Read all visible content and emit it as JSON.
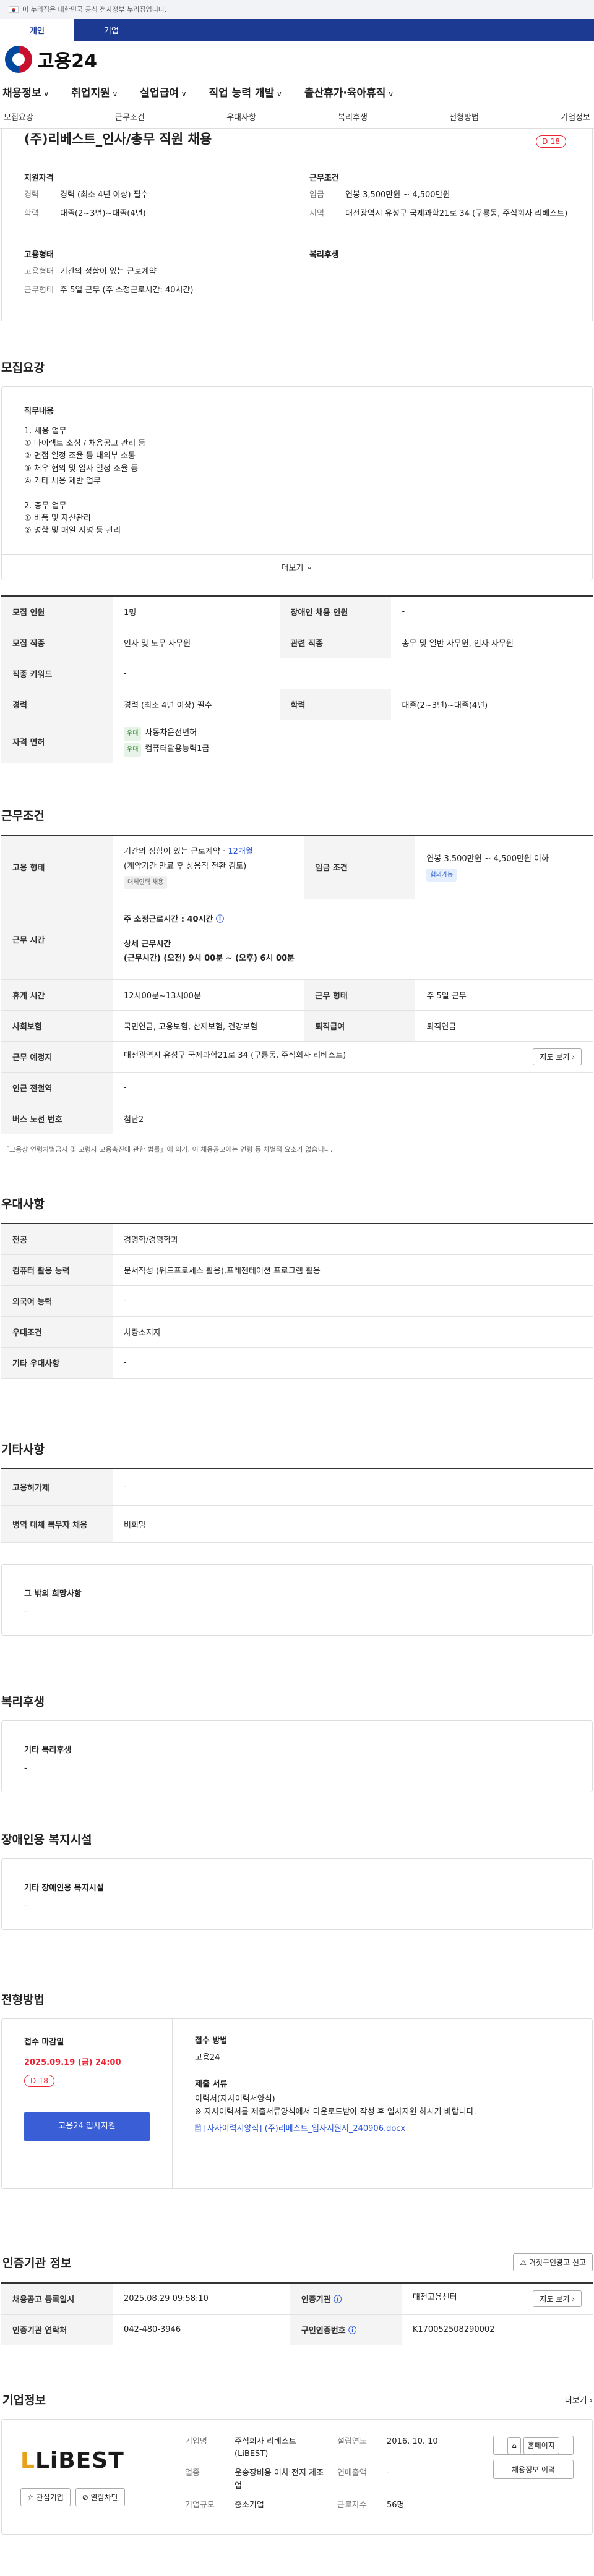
{
  "gov_banner": "이 누리집은 대한민국 공식 전자정부 누리집입니다.",
  "user_tabs": [
    "개인",
    "기업"
  ],
  "brand": "고용24",
  "gnb": [
    "채용정보",
    "취업지원",
    "실업급여",
    "직업 능력 개발",
    "출산휴가·육아휴직"
  ],
  "subnav": [
    "모집요강",
    "근무조건",
    "우대사항",
    "복리후생",
    "전형방법",
    "기업정보"
  ],
  "job": {
    "title": "(주)리베스트_인사/총무 직원 채용",
    "dday": "D-18"
  },
  "summary": {
    "qual_h": "지원자격",
    "cond_h": "근무조건",
    "type_h": "고용형태",
    "wel_h": "복리후생",
    "rows": [
      [
        "경력",
        "경력 (최소 4년 이상) 필수"
      ],
      [
        "학력",
        "대졸(2~3년)~대졸(4년)"
      ],
      [
        "임금",
        "연봉 3,500만원 ~ 4,500만원"
      ],
      [
        "지역",
        "대전광역시 유성구 국제과학21로 34 (구룡동, 주식회사 리베스트)"
      ],
      [
        "고용형태",
        "기간의 정함이 있는 근로계약"
      ],
      [
        "근무형태",
        "주 5일 근무 (주 소정근로시간: 40시간)"
      ]
    ]
  },
  "recruit": {
    "title": "모집요강",
    "duty_h": "직무내용",
    "duty": [
      "1. 채용 업무",
      "① 다이렉트 소싱 / 채용공고 관리 등",
      "② 면접 일정 조율 등 내외부 소통",
      "③ 처우 협의 및 입사 일정 조율 등",
      "④ 기타 채용 제반 업무",
      "",
      "2. 총무 업무",
      "① 비품 및 자산관리",
      "② 명함 및 매일 서명 등 관리"
    ],
    "more": "더보기",
    "rows": [
      [
        "모집 인원",
        "1명",
        "장애인 채용 인원",
        "-"
      ],
      [
        "모집 직종",
        "인사 및 노무 사무원",
        "관련 직종",
        "총무 및 일반 사무원, 인사 사무원"
      ],
      [
        "직종 키워드",
        "-",
        "",
        ""
      ],
      [
        "경력",
        "경력 (최소 4년 이상) 필수",
        "학력",
        "대졸(2~3년)~대졸(4년)"
      ]
    ],
    "license_h": "자격 면허",
    "lic_tag": "우대",
    "licenses": [
      "자동차운전면허",
      "컴퓨터활용능력1급"
    ]
  },
  "conditions": {
    "title": "근무조건",
    "emp_h": "고용 형태",
    "emp1": "기간의 정함이 있는 근로계약 · ",
    "emp_blue": "12개월",
    "emp2": "(계약기간 만료 후 상용직 전환 검토)",
    "emp_tag": "대체인력 채용",
    "wage_h": "임금 조건",
    "wage": "연봉 3,500만원 ~ 4,500만원 이하",
    "wage_tag": "협의가능",
    "time_h": "근무 시간",
    "time1": "주 소정근로시간 : 40시간",
    "time2": "상세 근무시간",
    "time3": "(근무시간) (오전) 9시 00분 ~ (오후) 6시 00분",
    "rest_h": "휴게 시간",
    "rest": "12시00분~13시00분",
    "form_h": "근무 형태",
    "form": "주 5일 근무",
    "ins_h": "사회보험",
    "ins": "국민연금, 고용보험, 산재보험, 건강보험",
    "ret_h": "퇴직급여",
    "ret": "퇴직연금",
    "loc_h": "근무 예정지",
    "loc": "대전광역시 유성구 국제과학21로 34 (구룡동, 주식회사 리베스트)",
    "map_btn": "지도 보기",
    "sub_h": "인근 전철역",
    "sub": "-",
    "bus_h": "버스 노선 번호",
    "bus": "첨단2",
    "note": "「고용상 연령차별금지 및 고령자 고용촉진에 관한 법률」에 의거, 이 채용공고에는 연령 등 차별적 요소가 없습니다."
  },
  "pref": {
    "title": "우대사항",
    "rows": [
      [
        "전공",
        "경영학/경영학과"
      ],
      [
        "컴퓨터 활용 능력",
        "문서작성 (워드프로세스 활용),프레젠테이션 프로그램 활용"
      ],
      [
        "외국어 능력",
        "-"
      ],
      [
        "우대조건",
        "차량소지자"
      ],
      [
        "기타 우대사항",
        "-"
      ]
    ]
  },
  "etc": {
    "title": "기타사항",
    "rows": [
      [
        "고용허가제",
        "-"
      ],
      [
        "병역 대체 복무자 채용",
        "비희망"
      ]
    ],
    "hope_h": "그 밖의 희망사항",
    "hope": "-"
  },
  "welfare": {
    "title": "복리후생",
    "h": "기타 복리후생",
    "v": "-"
  },
  "disabled": {
    "title": "장애인용 복지시설",
    "h": "기타 장애인용 복지시설",
    "v": "-"
  },
  "process": {
    "title": "전형방법",
    "dl_h": "접수 마감일",
    "dl": "2025.09.19 (금) 24:00",
    "dday": "D-18",
    "apply_btn": "고용24 입사지원",
    "method_h": "접수 방법",
    "method": "고용24",
    "docs_h": "제출 서류",
    "docs": "이력서(자사이력서양식)",
    "docs_note": "※ 자사이력서를 제출서류양식에서 다운로드받아 작성 후 입사지원 하시기 바랍니다.",
    "file": "[자사이력서양식] (주)리베스트_입사지원서_240906.docx"
  },
  "cert": {
    "title": "인증기관 정보",
    "report_btn": "거짓구인광고 신고",
    "rows": [
      [
        "채용공고 등록일시",
        "2025.08.29 09:58:10",
        "인증기관",
        "대전고용센터"
      ],
      [
        "인증기관 연락처",
        "042-480-3946",
        "구인인증번호",
        "K170052508290002"
      ]
    ],
    "map_btn": "지도 보기"
  },
  "company": {
    "title": "기업정보",
    "more": "더보기",
    "logo": "LiBEST",
    "fav": "관심기업",
    "block": "열람차단",
    "home": "홈페이지",
    "jobs": "채용정보 이력",
    "rows": [
      [
        "기업명",
        "주식회사 리베스트 (LiBEST)"
      ],
      [
        "설립연도",
        "2016. 10. 10"
      ],
      [
        "업종",
        "운송장비용 이차 전지 제조업"
      ],
      [
        "연매출액",
        "-"
      ],
      [
        "기업규모",
        "중소기업"
      ],
      [
        "근로자수",
        "56명"
      ]
    ]
  }
}
